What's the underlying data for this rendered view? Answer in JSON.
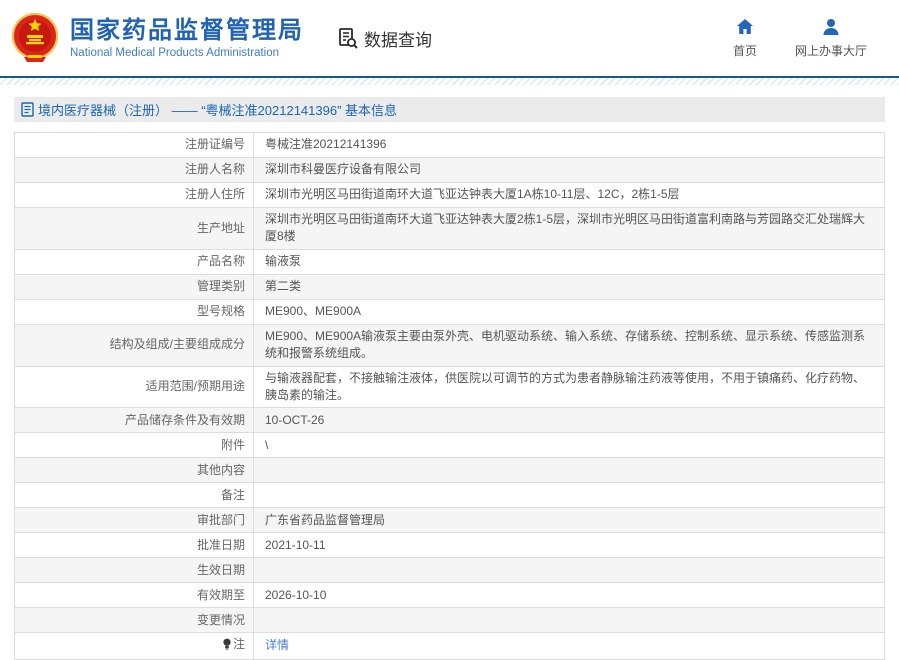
{
  "header": {
    "org_name_cn": "国家药品监督管理局",
    "org_name_en": "National Medical Products Administration",
    "nav": {
      "data_query": "数据查询",
      "home": "首页",
      "online_hall": "网上办事大厅"
    }
  },
  "section": {
    "title": "境内医疗器械（注册） —— “粤械注准20212141396” 基本信息"
  },
  "detail_table": {
    "rows": [
      {
        "label": "注册证编号",
        "value": "粤械注准20212141396"
      },
      {
        "label": "注册人名称",
        "value": "深圳市科曼医疗设备有限公司"
      },
      {
        "label": "注册人住所",
        "value": "深圳市光明区马田街道南环大道飞亚达钟表大厦1A栋10-11层、12C，2栋1-5层"
      },
      {
        "label": "生产地址",
        "value": "深圳市光明区马田街道南环大道飞亚达钟表大厦2栋1-5层，深圳市光明区马田街道富利南路与芳园路交汇处瑞辉大厦8楼"
      },
      {
        "label": "产品名称",
        "value": "输液泵"
      },
      {
        "label": "管理类别",
        "value": "第二类"
      },
      {
        "label": "型号规格",
        "value": "ME900、ME900A"
      },
      {
        "label": "结构及组成/主要组成成分",
        "value": "ME900、ME900A输液泵主要由泵外壳、电机驱动系统、输入系统、存储系统、控制系统、显示系统、传感监测系统和报警系统组成。"
      },
      {
        "label": "适用范围/预期用途",
        "value": "与输液器配套，不接触输注液体，供医院以可调节的方式为患者静脉输注药液等使用，不用于镇痛药、化疗药物、胰岛素的输注。"
      },
      {
        "label": "产品储存条件及有效期",
        "value": "10-OCT-26"
      },
      {
        "label": "附件",
        "value": "\\"
      },
      {
        "label": "其他内容",
        "value": ""
      },
      {
        "label": "备注",
        "value": ""
      },
      {
        "label": "审批部门",
        "value": "广东省药品监督管理局"
      },
      {
        "label": "批准日期",
        "value": "2021-10-11"
      },
      {
        "label": "生效日期",
        "value": ""
      },
      {
        "label": "有效期至",
        "value": "2026-10-10"
      },
      {
        "label": "变更情况",
        "value": ""
      },
      {
        "label": "注",
        "value": "详情",
        "is_link": true
      }
    ]
  },
  "colors": {
    "brand_blue": "#2062b4",
    "title_blue": "#1a66b3",
    "link_blue": "#4a7fd4",
    "icon_blue": "#2368b4",
    "divider_navy": "#1c5a8c",
    "row_alt_gray": "#f5f5f5",
    "emblem_red": "#d8261c",
    "emblem_gold": "#ffd700"
  }
}
